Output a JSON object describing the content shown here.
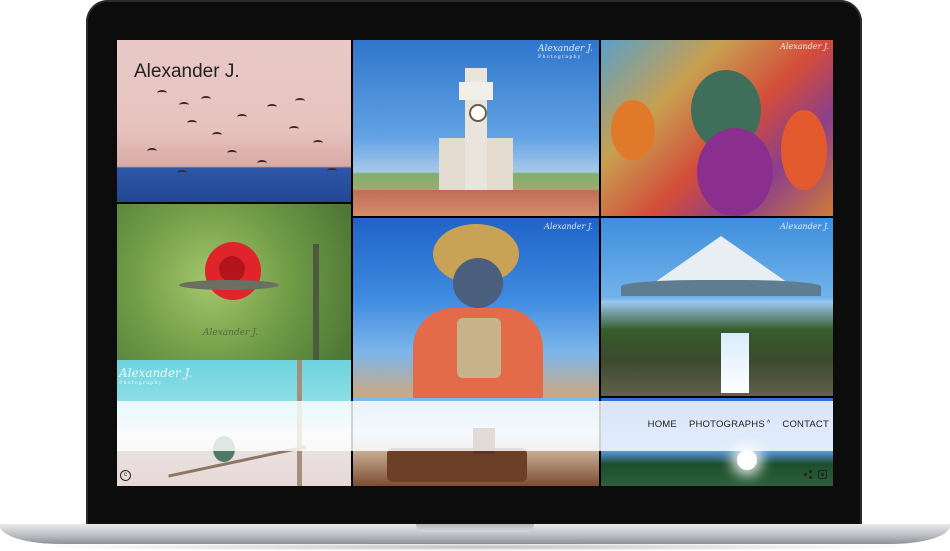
{
  "site": {
    "title": "Alexander J.",
    "watermark": "Alexander J.",
    "watermark_sub": "Photography"
  },
  "nav": {
    "items": [
      {
        "label": "HOME"
      },
      {
        "label": "PHOTOGRAPHS",
        "caret": "^"
      },
      {
        "label": "CONTACT"
      }
    ]
  },
  "footer": {
    "copyright_symbol": "c",
    "icons": [
      "share-icon",
      "instagram-icon"
    ]
  },
  "gallery": {
    "tiles": [
      {
        "name": "seagulls-over-sea"
      },
      {
        "name": "clock-tower"
      },
      {
        "name": "festival-mask-dancer"
      },
      {
        "name": "hummingbird-red-flower"
      },
      {
        "name": "diablada-dancer"
      },
      {
        "name": "osorno-volcano-waterfall"
      },
      {
        "name": "hummingbird-branch"
      },
      {
        "name": "rusty-locomotive"
      },
      {
        "name": "sunset-field"
      }
    ]
  },
  "colors": {
    "text": "#222222",
    "overlay": "rgba(255,255,255,0.82)",
    "frame": "#0c0c0d"
  }
}
